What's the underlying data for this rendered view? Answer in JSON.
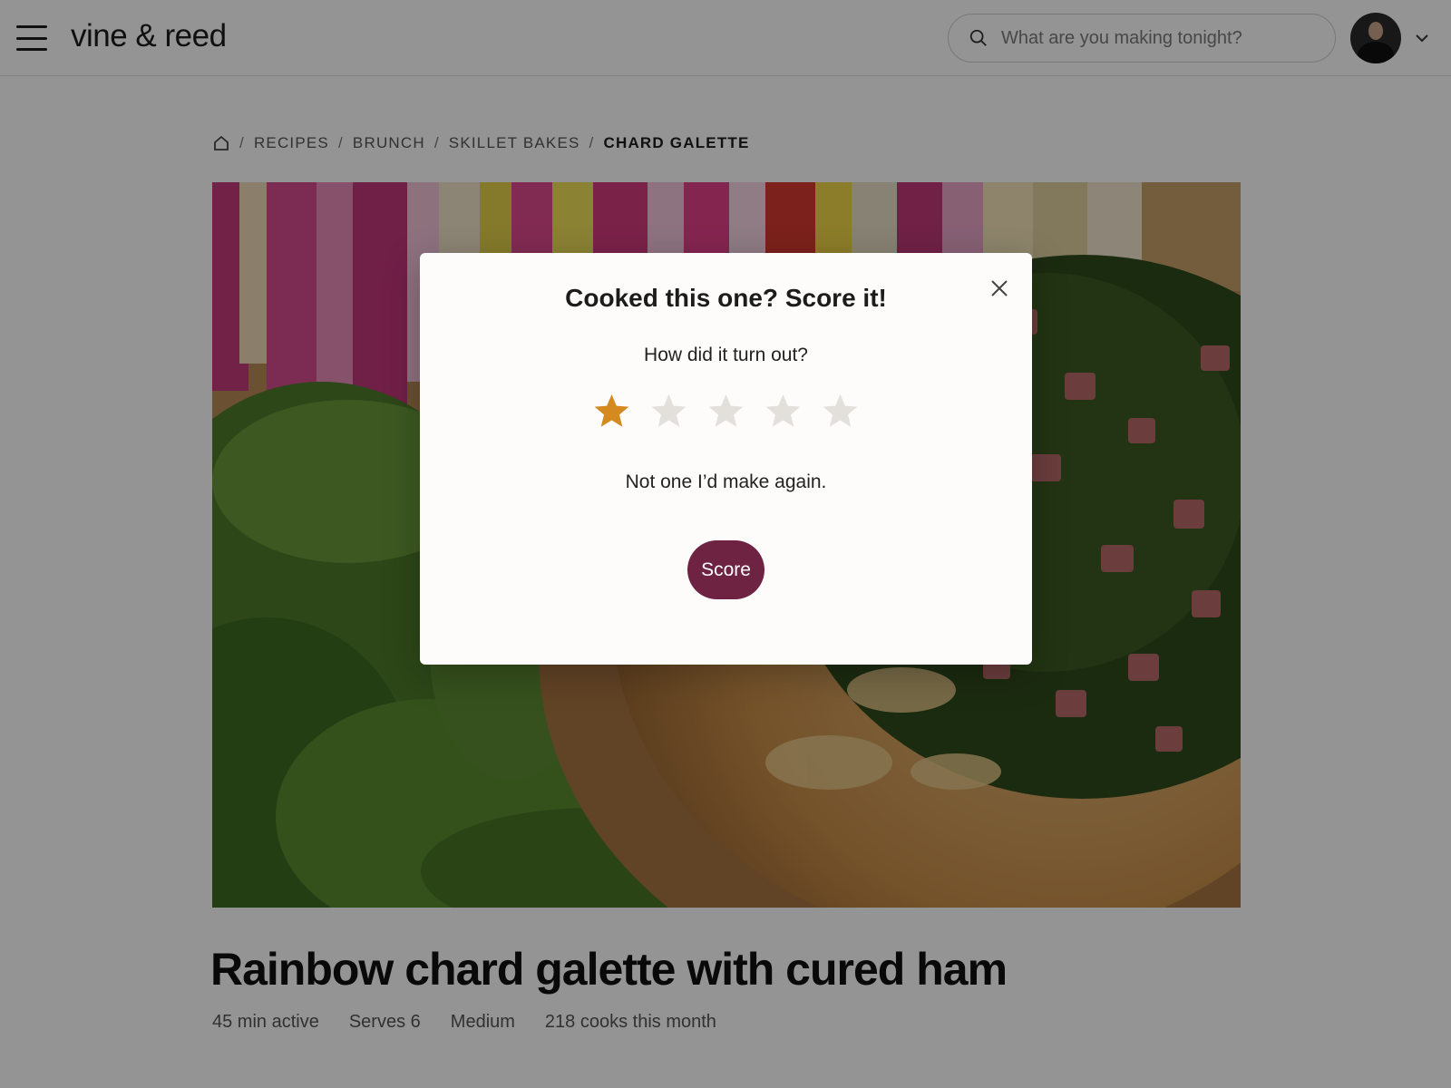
{
  "header": {
    "logo": "vine & reed",
    "search_placeholder": "What are you making tonight?"
  },
  "breadcrumb": {
    "items": [
      "RECIPES",
      "BRUNCH",
      "SKILLET BAKES"
    ],
    "current": "CHARD GALETTE"
  },
  "recipe": {
    "title": "Rainbow chard galette with cured ham",
    "meta": [
      "45 min active",
      "Serves 6",
      "Medium",
      "218 cooks this month"
    ]
  },
  "modal": {
    "title": "Cooked this one? Score it!",
    "prompt": "How did it turn out?",
    "rating": 1,
    "max_rating": 5,
    "feedback": "Not one I’d make again.",
    "submit_label": "Score"
  },
  "colors": {
    "star_filled": "#d48a1f",
    "star_empty": "#e3e0dc",
    "button": "#6e2342",
    "overlay": "rgba(0,0,0,0.42)"
  },
  "icons": {
    "menu": "hamburger-icon",
    "search": "search-icon",
    "home": "home-icon",
    "close": "close-icon",
    "star": "star-icon",
    "caret": "chevron-down-icon"
  }
}
